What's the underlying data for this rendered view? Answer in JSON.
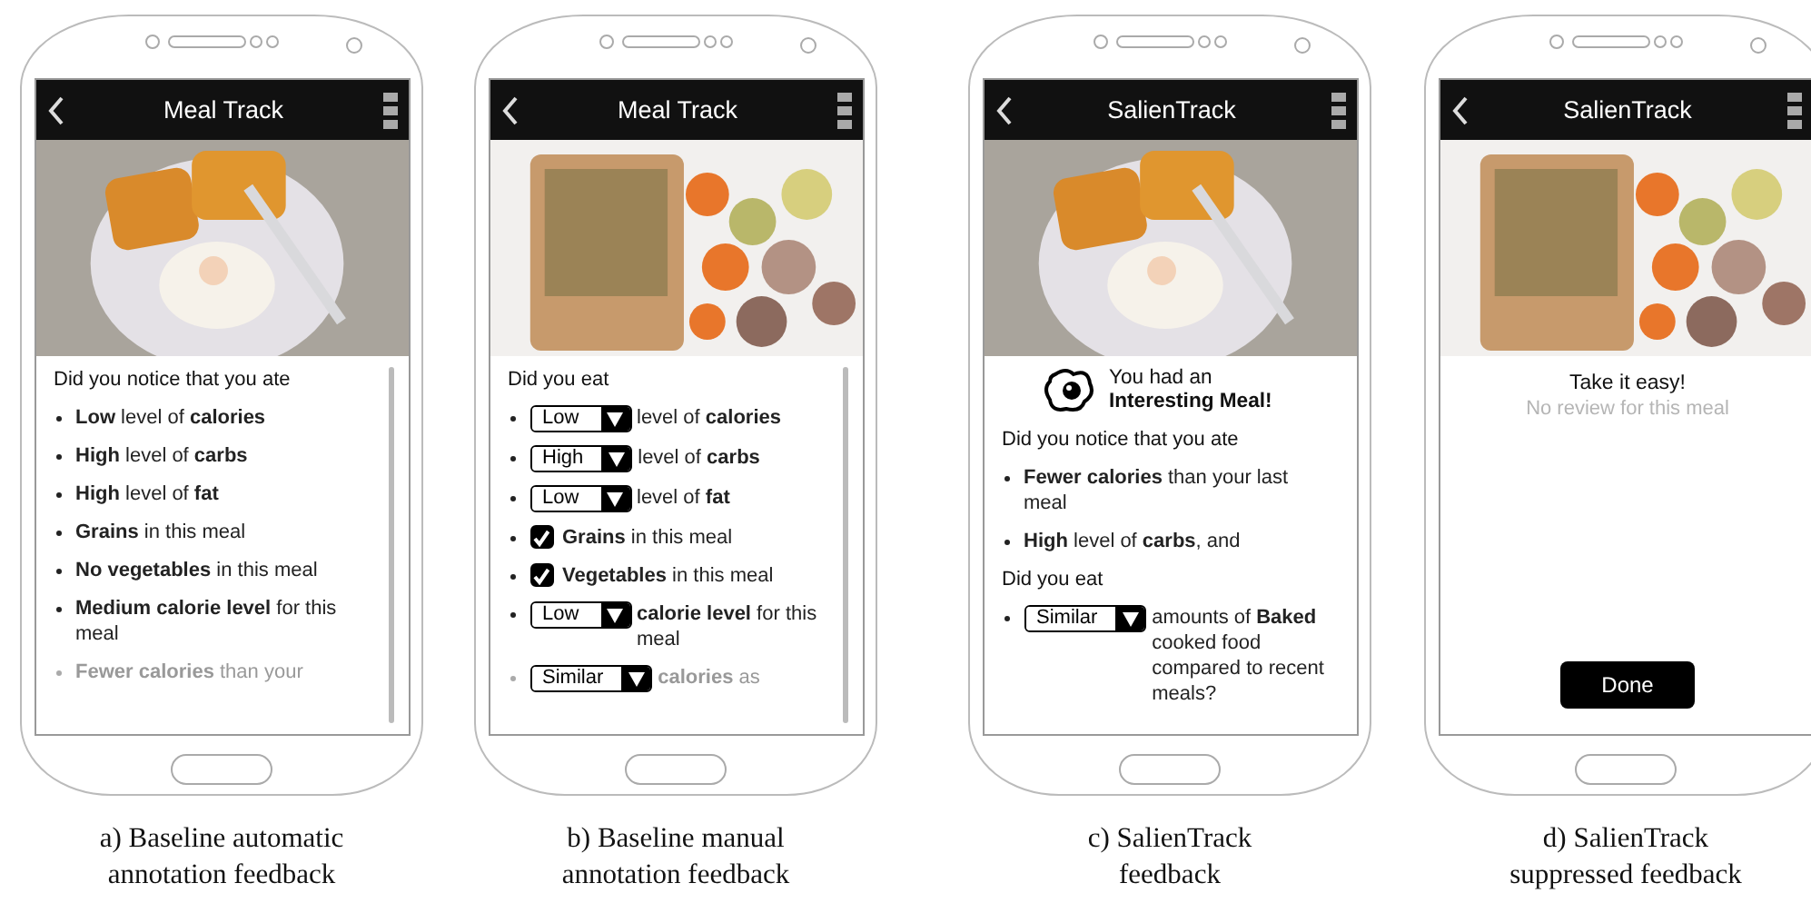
{
  "panels": [
    {
      "caption": [
        "a) Baseline automatic",
        "annotation feedback"
      ],
      "title": "Meal Track",
      "photo": {
        "kind": "hash-browns"
      },
      "kind": "list",
      "intro": "Did you notice that you ate",
      "scrollbar": true,
      "items": [
        {
          "kind": "text",
          "text": "**Low** level of **calories**",
          "faded": false
        },
        {
          "kind": "text",
          "text": "**High** level of **carbs**",
          "faded": false
        },
        {
          "kind": "text",
          "text": "**High** level of **fat**",
          "faded": false
        },
        {
          "kind": "text",
          "text": "**Grains** in this meal",
          "faded": false
        },
        {
          "kind": "text",
          "text": "**No vegetables** in this meal",
          "faded": false
        },
        {
          "kind": "text",
          "text": "**Medium calorie level** for this meal",
          "faded": false
        },
        {
          "kind": "text",
          "text": "**Fewer calories** than your",
          "faded": true
        }
      ]
    },
    {
      "caption": [
        "b) Baseline manual",
        "annotation feedback"
      ],
      "title": "Meal Track",
      "photo": {
        "kind": "salmon"
      },
      "kind": "list",
      "intro": "Did you eat",
      "scrollbar": true,
      "items": [
        {
          "kind": "dropdown",
          "value": "Low",
          "text": "level of **calories**",
          "faded": false
        },
        {
          "kind": "dropdown",
          "value": "High",
          "text": "level of **carbs**",
          "faded": false
        },
        {
          "kind": "dropdown",
          "value": "Low",
          "text": "level of **fat**",
          "faded": false
        },
        {
          "kind": "checkbox",
          "checked": true,
          "text": "**Grains** in this meal",
          "faded": false
        },
        {
          "kind": "checkbox",
          "checked": true,
          "text": "**Vegetables** in this meal",
          "faded": false
        },
        {
          "kind": "dropdown",
          "value": "Low",
          "text": "**calorie level** for this meal",
          "faded": false
        },
        {
          "kind": "dropdown",
          "value": "Similar",
          "text": "**calories** as",
          "faded": true
        }
      ]
    },
    {
      "caption": [
        "c) SalienTrack",
        "feedback"
      ],
      "title": "SalienTrack",
      "photo": {
        "kind": "hash-browns"
      },
      "kind": "salient",
      "heading": [
        "You had an",
        "Interesting Meal!"
      ],
      "blocks": [
        {
          "intro": "Did you notice that you ate",
          "items": [
            {
              "kind": "text",
              "text": "**Fewer calories** than your last meal",
              "faded": false
            },
            {
              "kind": "text",
              "text": "**High** level of **carbs**, and",
              "faded": false
            }
          ]
        },
        {
          "intro": "Did you eat",
          "items": [
            {
              "kind": "dropdown",
              "value": "Similar",
              "text": "amounts of **Baked** cooked food compared to recent meals?",
              "faded": false
            }
          ]
        }
      ]
    },
    {
      "caption": [
        "d) SalienTrack",
        "suppressed feedback"
      ],
      "title": "SalienTrack",
      "photo": {
        "kind": "salmon"
      },
      "kind": "suppressed",
      "message": "Take it easy!",
      "note": "No review for this meal",
      "button": "Done"
    }
  ]
}
